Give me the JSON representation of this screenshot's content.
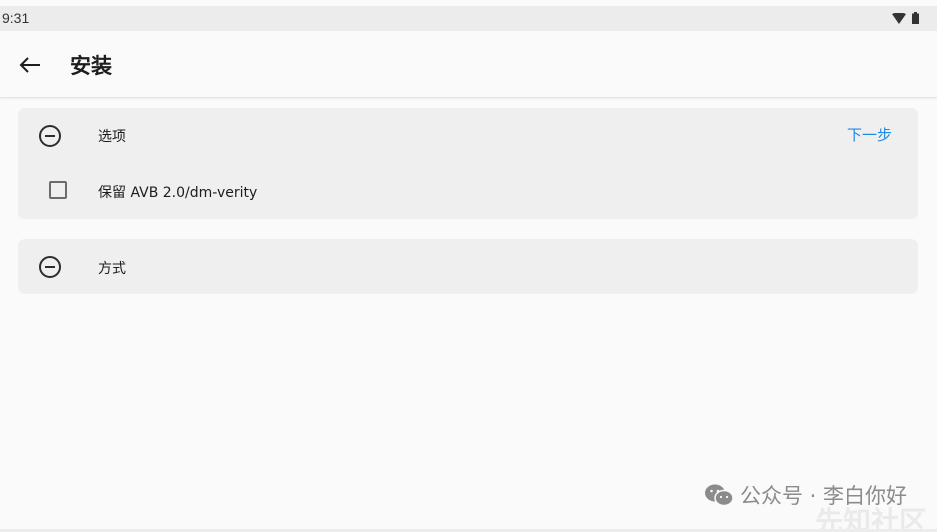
{
  "status_bar": {
    "time": "9:31",
    "icons": [
      "wifi-icon",
      "battery-icon"
    ]
  },
  "app_bar": {
    "back_icon": "arrow-left-icon",
    "title": "安装"
  },
  "options_card": {
    "icon": "minus-circle-icon",
    "title": "选项",
    "next_label": "下一步",
    "checkbox_label": "保留 AVB 2.0/dm-verity",
    "checkbox_checked": false
  },
  "method_card": {
    "icon": "minus-circle-icon",
    "title": "方式"
  },
  "watermark": {
    "icon": "wechat-icon",
    "text": "公众号 · 李白你好",
    "ghost_text": "先知社区"
  },
  "colors": {
    "accent": "#1e88e5",
    "card_bg": "#efefef",
    "page_bg": "#fafafa"
  }
}
